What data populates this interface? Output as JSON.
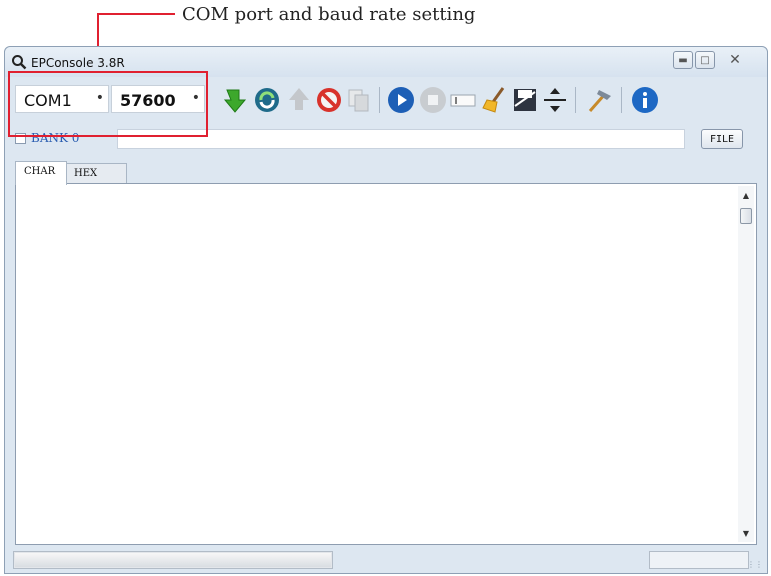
{
  "annotation": {
    "text": "COM port and baud rate setting"
  },
  "window": {
    "title": "EPConsole 3.8R"
  },
  "toolbar": {
    "port": {
      "value": "COM1"
    },
    "baud": {
      "value": "57600"
    },
    "icons": [
      "download-icon",
      "refresh-icon",
      "upload-icon",
      "stop-icon",
      "copy-icon",
      "play-icon",
      "record-stop-icon",
      "text-input-icon",
      "broom-icon",
      "save-icon",
      "split-icon",
      "tool-icon",
      "info-icon"
    ]
  },
  "bank": {
    "label": "BANK 0",
    "checked": false,
    "file_button": "FILE"
  },
  "tabs": [
    {
      "label": "CHAR"
    },
    {
      "label": "HEX"
    }
  ],
  "colors": {
    "annotation_red": "#e02030",
    "window_bg": "#dde7f1"
  }
}
